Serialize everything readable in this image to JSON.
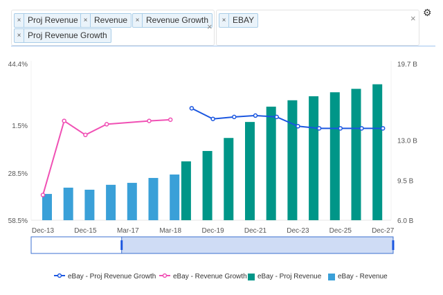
{
  "filters": {
    "metrics": [
      "Proj Revenue",
      "Revenue",
      "Revenue Growth",
      "Proj Revenue Growth"
    ],
    "tickers": [
      "EBAY"
    ],
    "remove_symbol": "×",
    "clear_symbol": "×"
  },
  "settings_icon": "gear-icon",
  "chart_data": {
    "type": "bar",
    "categories": [
      "Dec-13",
      "Dec-14",
      "Dec-15",
      "Dec-16",
      "Mar-17",
      "Dec-17",
      "Mar-18",
      "Dec-18",
      "Dec-19",
      "Dec-20",
      "Dec-21",
      "Dec-22",
      "Dec-23",
      "Dec-24",
      "Dec-25",
      "Dec-26",
      "Dec-27"
    ],
    "x_tick_labels": [
      "Dec-13",
      "Dec-15",
      "Mar-17",
      "Mar-18",
      "Dec-19",
      "Dec-21",
      "Dec-23",
      "Dec-25",
      "Dec-27"
    ],
    "left_axis": {
      "ticks": [
        "44.4%",
        "1.5%",
        "28.5%",
        "58.5%"
      ],
      "tick_values": [
        44.4,
        1.5,
        -28.5,
        -58.5
      ],
      "ylim": [
        -58.5,
        44.4
      ]
    },
    "right_axis": {
      "ticks": [
        "19.7 B",
        "13.0 B",
        "9.5 B",
        "6.0 B"
      ],
      "tick_values": [
        19.7,
        13.0,
        9.5,
        6.0
      ],
      "ylim": [
        6.0,
        19.7
      ]
    },
    "series": [
      {
        "name": "eBay - Proj Revenue Growth",
        "type": "line",
        "axis": "left",
        "color": "#1a56e0",
        "values": [
          null,
          null,
          null,
          null,
          null,
          null,
          null,
          15.1,
          8.1,
          9.4,
          10.3,
          9.4,
          3.3,
          1.9,
          1.9,
          1.9,
          1.9
        ]
      },
      {
        "name": "eBay - Revenue Growth",
        "type": "line",
        "axis": "left",
        "color": "#f050b4",
        "values": [
          -41.9,
          6.8,
          -2.4,
          4.6,
          null,
          6.8,
          7.6,
          null,
          null,
          null,
          null,
          null,
          null,
          null,
          null,
          null,
          null
        ]
      },
      {
        "name": "eBay - Proj Revenue",
        "type": "bar",
        "axis": "right",
        "color": "#009688",
        "values": [
          null,
          null,
          null,
          null,
          null,
          null,
          null,
          11.15,
          12.06,
          13.2,
          14.6,
          15.94,
          16.5,
          16.85,
          17.2,
          17.5,
          17.9
        ]
      },
      {
        "name": "eBay - Revenue",
        "type": "bar",
        "axis": "right",
        "color": "#3aa0d8",
        "values": [
          8.3,
          8.85,
          8.67,
          9.1,
          9.27,
          9.7,
          10.0,
          null,
          null,
          null,
          null,
          null,
          null,
          null,
          null,
          null,
          null
        ]
      }
    ],
    "navigator": {
      "selected_range_fraction": [
        0.25,
        1.0
      ]
    }
  }
}
